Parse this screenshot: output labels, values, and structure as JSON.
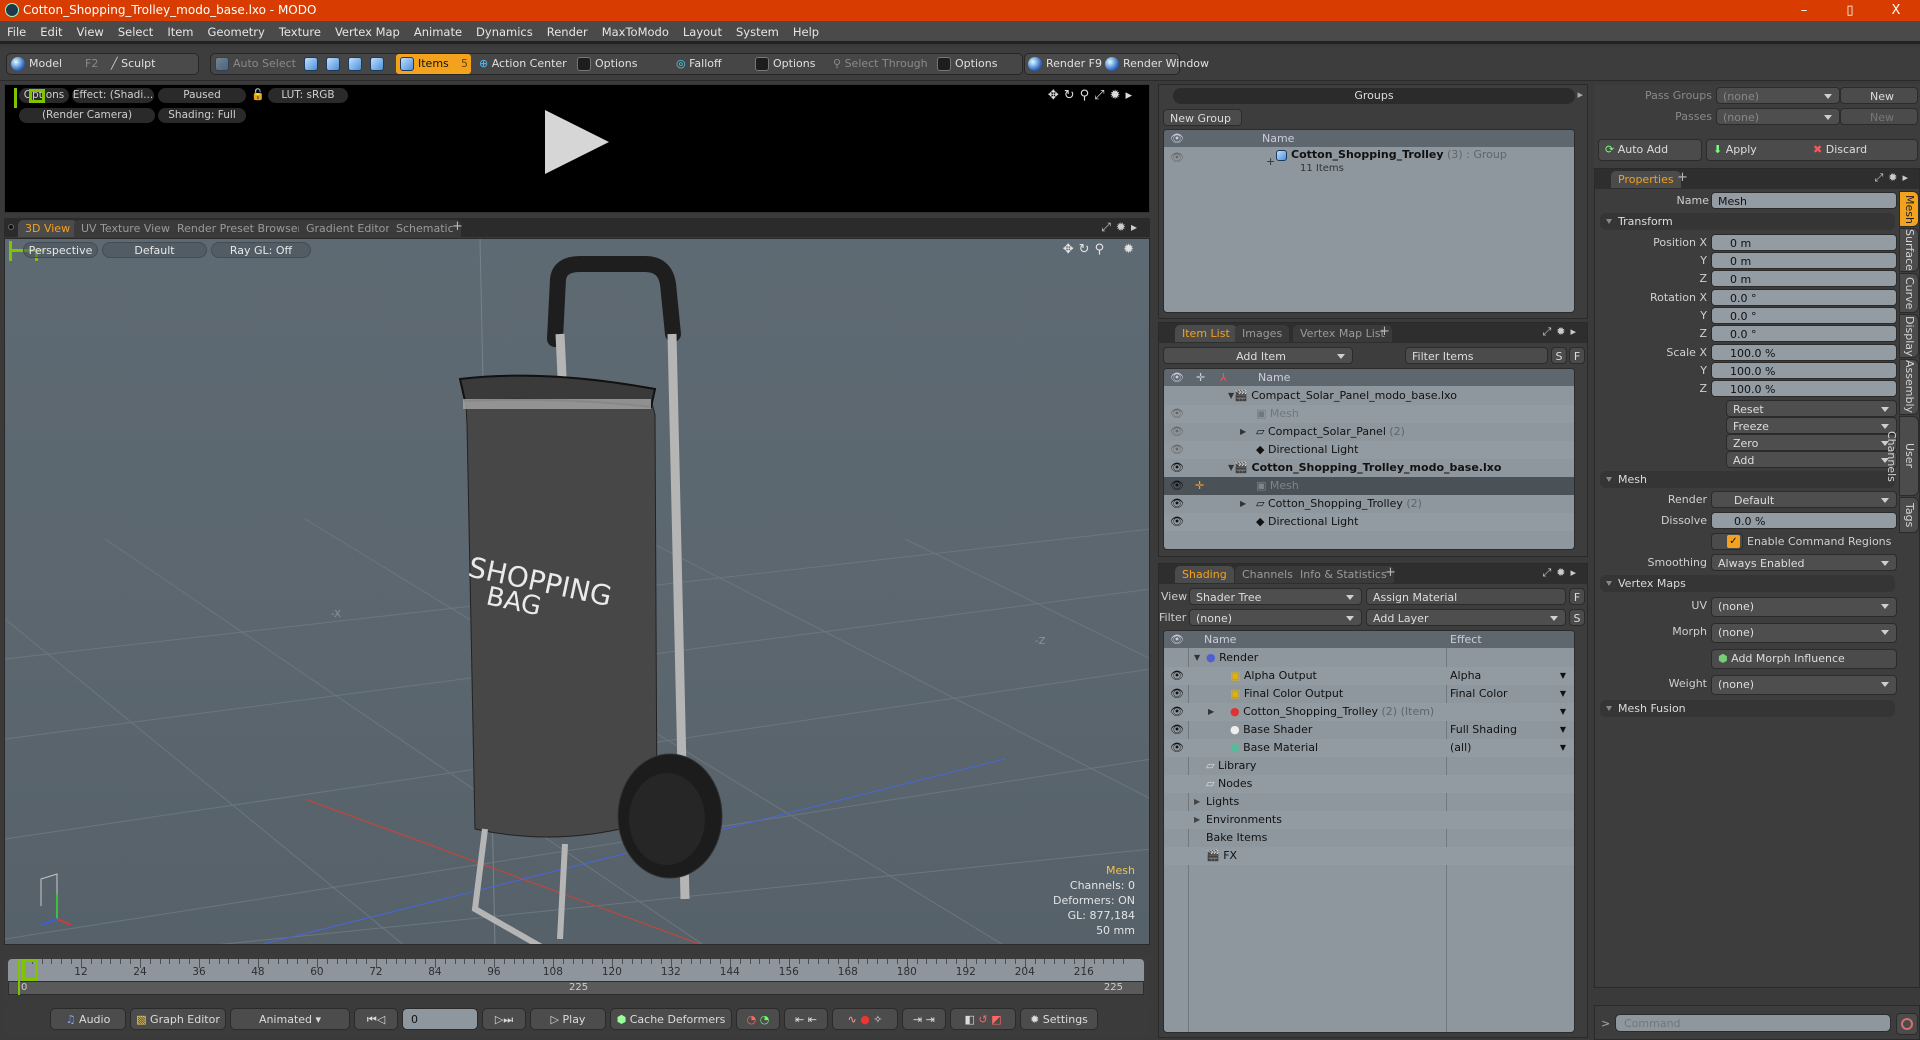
{
  "window": {
    "title": "Cotton_Shopping_Trolley_modo_base.lxo - MODO",
    "minimize": "–",
    "restore": "▯",
    "close": "X"
  },
  "menu": [
    "File",
    "Edit",
    "View",
    "Select",
    "Item",
    "Geometry",
    "Texture",
    "Vertex Map",
    "Animate",
    "Dynamics",
    "Render",
    "MaxToModo",
    "Layout",
    "System",
    "Help"
  ],
  "toolbar": {
    "model": "Model",
    "model_key": "F2",
    "sculpt": "Sculpt",
    "auto_select": "Auto Select",
    "items": "Items",
    "items_count": "5",
    "action_center": "Action Center",
    "options1": "Options",
    "falloff": "Falloff",
    "options2": "Options",
    "select_through": "Select Through",
    "options3": "Options",
    "render": "Render",
    "render_key": "F9",
    "render_window": "Render Window"
  },
  "render_preview": {
    "options": "Options",
    "effect": "Effect: (Shadi...",
    "paused": "Paused",
    "lut": "LUT: sRGB",
    "camera": "(Render Camera)",
    "shading": "Shading: Full"
  },
  "viewport_tabs": [
    "3D View",
    "UV Texture View",
    "Render Preset Browser",
    "Gradient Editor",
    "Schematic"
  ],
  "viewport": {
    "perspective": "Perspective",
    "default": "Default",
    "raygl": "Ray GL: Off",
    "axis_neg_x": "-X",
    "axis_neg_z": "-Z",
    "stats": {
      "selection": "Mesh",
      "channels": "Channels: 0",
      "deformers": "Deformers: ON",
      "gl": "GL: 877,184",
      "scale": "50 mm"
    },
    "bag_text_1": "SHOPPING",
    "bag_text_2": "BAG"
  },
  "timeline": {
    "ticks": [
      "12",
      "24",
      "36",
      "48",
      "60",
      "72",
      "84",
      "96",
      "108",
      "120",
      "132",
      "144",
      "156",
      "168",
      "180",
      "192",
      "204",
      "216"
    ],
    "start": "0",
    "mid": "225",
    "end": "225",
    "current": "0",
    "max_frame": 225
  },
  "bottombar": {
    "audio": "Audio",
    "graph_editor": "Graph Editor",
    "animated": "Animated",
    "frame": "0",
    "play": "Play",
    "cache_deformers": "Cache Deformers",
    "settings": "Settings"
  },
  "groups": {
    "title": "Groups",
    "new_group": "New Group",
    "col_name": "Name",
    "rows": [
      {
        "name": "Cotton_Shopping_Trolley",
        "count": "(3)",
        "type": ": Group",
        "sub": "11 Items"
      }
    ]
  },
  "itemlist": {
    "tabs": [
      "Item List",
      "Images",
      "Vertex Map List"
    ],
    "add_item": "Add Item",
    "filter": "Filter Items",
    "s": "S",
    "f": "F",
    "col_name": "Name",
    "rows": [
      {
        "name": "Compact_Solar_Panel_modo_base.lxo",
        "extra": "",
        "icon": "scene-icon",
        "bold": false,
        "dim": false
      },
      {
        "name": "Mesh",
        "extra": "",
        "icon": "mesh-icon",
        "bold": false,
        "dim": true
      },
      {
        "name": "Compact_Solar_Panel",
        "extra": "(2)",
        "icon": "folder-icon",
        "bold": false,
        "dim": false
      },
      {
        "name": "Directional Light",
        "extra": "",
        "icon": "light-icon",
        "bold": false,
        "dim": false
      },
      {
        "name": "Cotton_Shopping_Trolley_modo_base.lxo",
        "extra": "",
        "icon": "scene-icon",
        "bold": true,
        "dim": false
      },
      {
        "name": "Mesh",
        "extra": "",
        "icon": "mesh-icon",
        "bold": false,
        "dim": true,
        "selected": true
      },
      {
        "name": "Cotton_Shopping_Trolley",
        "extra": "(2)",
        "icon": "folder-icon",
        "bold": false,
        "dim": false
      },
      {
        "name": "Directional Light",
        "extra": "",
        "icon": "light-icon",
        "bold": false,
        "dim": false
      }
    ]
  },
  "shading": {
    "tabs": [
      "Shading",
      "Channels",
      "Info & Statistics"
    ],
    "view_label": "View",
    "view_value": "Shader Tree",
    "assign_material": "Assign Material",
    "f": "F",
    "filter_label": "Filter",
    "filter_value": "(none)",
    "add_layer": "Add Layer",
    "s": "S",
    "col_name": "Name",
    "col_effect": "Effect",
    "rows": [
      {
        "name": "Render",
        "extra": "",
        "effect": ""
      },
      {
        "name": "Alpha Output",
        "extra": "",
        "effect": "Alpha"
      },
      {
        "name": "Final Color Output",
        "extra": "",
        "effect": "Final Color"
      },
      {
        "name": "Cotton_Shopping_Trolley",
        "extra": "(2) (Item)",
        "effect": ""
      },
      {
        "name": "Base Shader",
        "extra": "",
        "effect": "Full Shading"
      },
      {
        "name": "Base Material",
        "extra": "",
        "effect": "(all)"
      },
      {
        "name": "Library",
        "extra": "",
        "effect": ""
      },
      {
        "name": "Nodes",
        "extra": "",
        "effect": ""
      },
      {
        "name": "Lights",
        "extra": "",
        "effect": ""
      },
      {
        "name": "Environments",
        "extra": "",
        "effect": ""
      },
      {
        "name": "Bake Items",
        "extra": "",
        "effect": ""
      },
      {
        "name": "FX",
        "extra": "",
        "effect": ""
      }
    ]
  },
  "passes": {
    "pass_groups_label": "Pass Groups",
    "pass_groups_value": "(none)",
    "new1": "New",
    "passes_label": "Passes",
    "passes_value": "(none)",
    "new2": "New",
    "auto_add": "Auto Add",
    "apply": "Apply",
    "discard": "Discard"
  },
  "properties": {
    "tab": "Properties",
    "name_label": "Name",
    "name_value": "Mesh",
    "transform": "Transform",
    "position_label": "Position X",
    "pos": [
      "0 m",
      "0 m",
      "0 m"
    ],
    "rotation_label": "Rotation X",
    "rot": [
      "0.0 °",
      "0.0 °",
      "0.0 °"
    ],
    "scale_label": "Scale X",
    "scl": [
      "100.0 %",
      "100.0 %",
      "100.0 %"
    ],
    "y": "Y",
    "z": "Z",
    "reset": "Reset",
    "freeze": "Freeze",
    "zero": "Zero",
    "add": "Add",
    "mesh": "Mesh",
    "render_label": "Render",
    "render_value": "Default",
    "dissolve_label": "Dissolve",
    "dissolve_value": "0.0 %",
    "enable_cmd": "Enable Command Regions",
    "smoothing_label": "Smoothing",
    "smoothing_value": "Always Enabled",
    "vertex_maps": "Vertex Maps",
    "uv_label": "UV",
    "uv_value": "(none)",
    "morph_label": "Morph",
    "morph_value": "(none)",
    "add_morph": "Add Morph Influence",
    "weight_label": "Weight",
    "weight_value": "(none)",
    "mesh_fusion": "Mesh Fusion",
    "side_tabs": [
      "Mesh",
      "Surface",
      "Curve",
      "Display",
      "Assembly",
      "User Channels",
      "Tags"
    ]
  },
  "command": {
    "prompt": ">",
    "placeholder": "Command"
  },
  "colors": {
    "accent": "#f3a21d",
    "titlebar": "#d93c00",
    "list_bg": "#8f979e"
  }
}
